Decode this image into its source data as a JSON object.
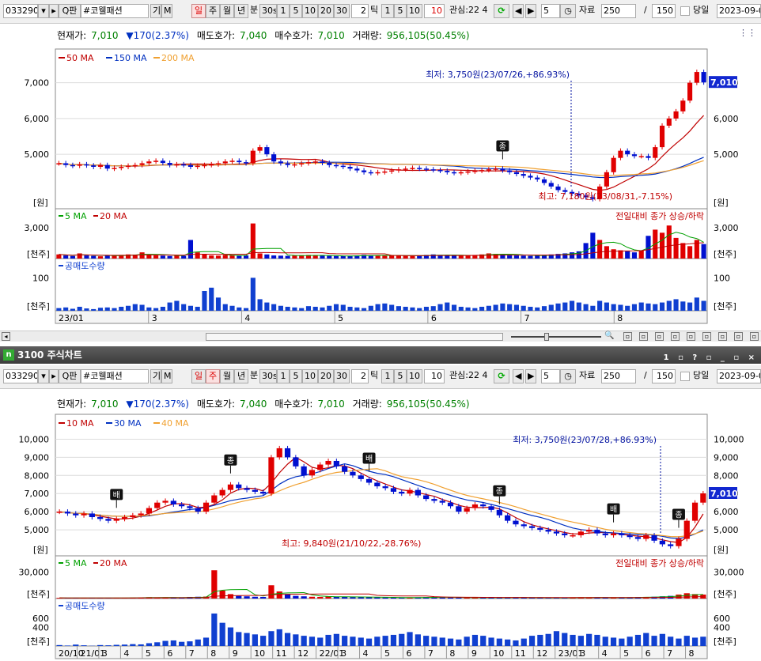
{
  "toolbar": {
    "code": "033290",
    "name": "#코웰패션",
    "gi": "기",
    "m": "M",
    "periods": [
      "일",
      "주",
      "월",
      "년",
      "분",
      "30s"
    ],
    "nums": [
      "1",
      "5",
      "10",
      "20",
      "30"
    ],
    "tick_val": "2",
    "tick_lbl": "틱",
    "tnums": [
      "1",
      "5",
      "10"
    ],
    "tick_in": "10",
    "gwansim": "관심:22 4",
    "count": "5",
    "jaryo": "자료",
    "jaryo_val": "250",
    "slash": "/",
    "page_val": "150",
    "dangil": "당일",
    "date": "2023-09-0"
  },
  "toolbar2": {
    "tick_in": "10"
  },
  "info": {
    "cur_lbl": "현재가:",
    "cur": "7,010",
    "change": "▼170(2.37%)",
    "ask_lbl": "매도호가:",
    "ask": "7,040",
    "bid_lbl": "매수호가:",
    "bid": "7,010",
    "vol_lbl": "거래량:",
    "vol": "956,105(50.45%)"
  },
  "chart_data": [
    {
      "type": "line",
      "title": "",
      "period": "daily",
      "ma_legend": [
        "50 MA",
        "150 MA",
        "200 MA"
      ],
      "ma_colors": [
        "#c00000",
        "#0030c0",
        "#f0a030"
      ],
      "y_ticks": [
        "7,000",
        "6,000",
        "5,000"
      ],
      "y_unit": "[원]",
      "current": "7,010",
      "x_labels": [
        "23/01",
        "3",
        "4",
        "5",
        "6",
        "7",
        "8"
      ],
      "annot_low": "최저: 3,750원(23/07/26,+86.93%)",
      "annot_high": "최고: 7,180원(23/08/31,-7.15%)",
      "marker": "종",
      "vol_legend": [
        "5 MA",
        "20 MA"
      ],
      "vol_colors": [
        "#00a000",
        "#c00000"
      ],
      "vol_tick": "3,000",
      "vol_unit": "[천주]",
      "vol_note": "전일대비 종가 상승/하락",
      "short_legend": "공매도수량",
      "short_tick": "100",
      "short_unit": "[천주]",
      "closes": [
        4750,
        4700,
        4680,
        4720,
        4690,
        4650,
        4700,
        4600,
        4620,
        4650,
        4680,
        4700,
        4750,
        4800,
        4820,
        4760,
        4700,
        4720,
        4700,
        4650,
        4680,
        4700,
        4720,
        4750,
        4800,
        4820,
        4780,
        4750,
        5100,
        5200,
        5000,
        4800,
        4750,
        4700,
        4720,
        4750,
        4780,
        4800,
        4760,
        4700,
        4680,
        4650,
        4600,
        4550,
        4500,
        4480,
        4500,
        4520,
        4550,
        4580,
        4600,
        4620,
        4600,
        4580,
        4560,
        4540,
        4500,
        4480,
        4500,
        4520,
        4540,
        4560,
        4580,
        4600,
        4550,
        4500,
        4450,
        4400,
        4350,
        4300,
        4200,
        4100,
        4000,
        3950,
        3900,
        3850,
        3800,
        3750,
        4100,
        4500,
        4900,
        5100,
        5000,
        4950,
        4950,
        4900,
        5200,
        5800,
        6000,
        6200,
        6500,
        7000,
        7300,
        7010
      ],
      "volumes": [
        400,
        300,
        250,
        500,
        300,
        260,
        220,
        300,
        280,
        350,
        400,
        380,
        600,
        350,
        300,
        280,
        250,
        300,
        270,
        1800,
        600,
        400,
        300,
        280,
        350,
        300,
        260,
        300,
        3400,
        500,
        400,
        300,
        280,
        260,
        300,
        320,
        350,
        300,
        280,
        260,
        250,
        230,
        260,
        300,
        350,
        300,
        280,
        320,
        300,
        280,
        260,
        250,
        300,
        350,
        400,
        350,
        300,
        280,
        300,
        320,
        350,
        400,
        500,
        450,
        400,
        350,
        300,
        280,
        260,
        300,
        350,
        400,
        450,
        500,
        600,
        700,
        1500,
        2500,
        1800,
        1200,
        900,
        800,
        700,
        600,
        800,
        2200,
        2800,
        2500,
        3200,
        2000,
        1500,
        1200,
        1800,
        1400
      ],
      "shorts": [
        8,
        10,
        6,
        12,
        7,
        5,
        9,
        10,
        8,
        12,
        15,
        20,
        18,
        10,
        8,
        12,
        25,
        30,
        20,
        15,
        12,
        60,
        70,
        40,
        20,
        15,
        10,
        8,
        100,
        35,
        25,
        20,
        15,
        12,
        10,
        8,
        14,
        12,
        10,
        15,
        20,
        18,
        12,
        10,
        8,
        15,
        20,
        22,
        18,
        14,
        12,
        10,
        8,
        12,
        14,
        20,
        25,
        18,
        12,
        10,
        8,
        12,
        15,
        18,
        22,
        20,
        18,
        15,
        12,
        10,
        14,
        18,
        22,
        25,
        30,
        25,
        20,
        15,
        30,
        25,
        20,
        18,
        15,
        20,
        25,
        22,
        20,
        25,
        30,
        35,
        28,
        25,
        40,
        30
      ]
    },
    {
      "type": "line",
      "title": "3100 주식차트",
      "period": "weekly",
      "ma_legend": [
        "10 MA",
        "30 MA",
        "40 MA"
      ],
      "ma_colors": [
        "#c00000",
        "#0030c0",
        "#f0a030"
      ],
      "y_ticks": [
        "10,000",
        "9,000",
        "8,000",
        "7,000",
        "6,000",
        "5,000"
      ],
      "y_unit": "[원]",
      "current": "7,010",
      "x_labels": [
        "20/10",
        "21/01",
        "3",
        "4",
        "5",
        "6",
        "7",
        "8",
        "9",
        "10",
        "11",
        "12",
        "22/01",
        "3",
        "4",
        "5",
        "6",
        "7",
        "8",
        "9",
        "10",
        "11",
        "12",
        "23/01",
        "3",
        "4",
        "5",
        "6",
        "7",
        "8"
      ],
      "annot_low": "최저: 3,750원(23/07/28,+86.93%)",
      "annot_high": "최고: 9,840원(21/10/22,-28.76%)",
      "markers": [
        "배",
        "종",
        "배",
        "종",
        "배",
        "종"
      ],
      "vol_legend": [
        "5 MA",
        "20 MA"
      ],
      "vol_colors": [
        "#00a000",
        "#c00000"
      ],
      "vol_tick": "30,000",
      "vol_unit": "[천주]",
      "vol_note": "전일대비 종가 상승/하락",
      "short_legend": "공매도수량",
      "short_ticks": [
        "600",
        "400"
      ],
      "short_unit": "[천주]",
      "closes": [
        6000,
        5900,
        5800,
        5900,
        5700,
        5600,
        5500,
        5600,
        5700,
        5800,
        5900,
        6200,
        6500,
        6600,
        6400,
        6300,
        6200,
        6000,
        6500,
        6900,
        7200,
        7500,
        7300,
        7200,
        7100,
        7000,
        9000,
        9500,
        9000,
        8500,
        8000,
        8300,
        8600,
        8800,
        8500,
        8200,
        8000,
        7800,
        7600,
        7400,
        7300,
        7100,
        7000,
        7200,
        6900,
        6700,
        6600,
        6500,
        6300,
        6000,
        6200,
        6400,
        6300,
        6100,
        5800,
        5500,
        5300,
        5200,
        5100,
        5000,
        4900,
        4800,
        4700,
        4700,
        4900,
        5000,
        4800,
        4700,
        4800,
        4700,
        4600,
        4500,
        4700,
        4400,
        4200,
        4100,
        4500,
        5500,
        6500,
        7010
      ],
      "volumes": [
        800,
        600,
        700,
        900,
        500,
        600,
        700,
        800,
        900,
        1000,
        1200,
        1500,
        1300,
        1100,
        1000,
        900,
        1800,
        2000,
        2200,
        32000,
        9000,
        5000,
        3000,
        2500,
        2000,
        1800,
        15000,
        8000,
        5000,
        3000,
        2500,
        2000,
        1800,
        2200,
        2000,
        1800,
        1600,
        1500,
        1400,
        1300,
        1200,
        1100,
        1000,
        1200,
        1400,
        1600,
        1500,
        1300,
        1200,
        1100,
        1000,
        900,
        1000,
        1200,
        1400,
        1300,
        1200,
        1100,
        1000,
        900,
        800,
        900,
        1000,
        1200,
        1400,
        1300,
        1200,
        1100,
        1000,
        1200,
        1400,
        1600,
        1800,
        2000,
        2500,
        3000,
        4500,
        6000,
        5000,
        4500
      ],
      "shorts": [
        20,
        10,
        30,
        15,
        5,
        20,
        15,
        25,
        30,
        40,
        35,
        60,
        80,
        110,
        120,
        90,
        100,
        140,
        180,
        700,
        500,
        400,
        300,
        280,
        250,
        220,
        320,
        360,
        280,
        250,
        220,
        200,
        180,
        240,
        260,
        220,
        200,
        180,
        160,
        200,
        220,
        240,
        260,
        300,
        250,
        220,
        200,
        180,
        160,
        140,
        200,
        240,
        220,
        180,
        160,
        140,
        120,
        160,
        220,
        240,
        260,
        320,
        280,
        240,
        220,
        260,
        240,
        200,
        180,
        160,
        200,
        240,
        280,
        220,
        260,
        200,
        160,
        220,
        180,
        200
      ]
    }
  ]
}
